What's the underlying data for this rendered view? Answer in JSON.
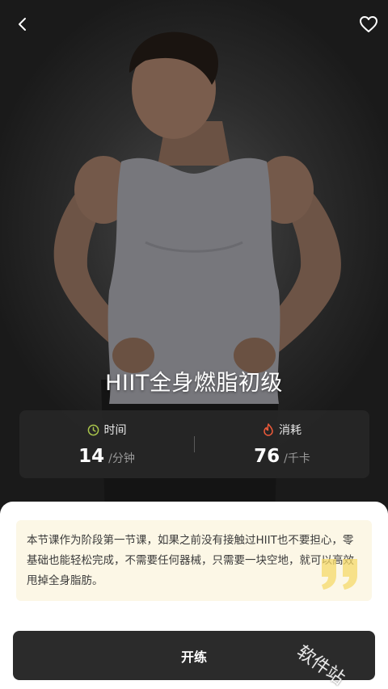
{
  "course": {
    "title": "HIIT全身燃脂初级"
  },
  "stats": {
    "time": {
      "label": "时间",
      "value": "14",
      "unit": "/分钟"
    },
    "calories": {
      "label": "消耗",
      "value": "76",
      "unit": "/千卡"
    }
  },
  "description": "本节课作为阶段第一节课，如果之前没有接触过HIIT也不要担心，零基础也能轻松完成，不需要任何器械，只需要一块空地，就可以高效甩掉全身脂肪。",
  "start_button": "开练",
  "watermark": "软件站",
  "colors": {
    "time_icon": "#a8c34a",
    "calorie_icon": "#ef5a3a",
    "desc_bg": "#fcf7e6",
    "quote": "#f6d96a",
    "button_bg": "#2b2b2b"
  },
  "icons": {
    "back": "chevron-left-icon",
    "favorite": "heart-outline-icon",
    "time": "clock-icon",
    "calories": "flame-icon",
    "quote": "quote-icon"
  }
}
